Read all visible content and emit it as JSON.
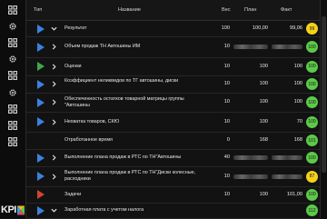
{
  "header": {
    "type_label": "Тип",
    "name_label": "Название",
    "weight_label": "Вес",
    "plan_label": "План",
    "fact_label": "Факт"
  },
  "logo": {
    "text": "KPI"
  },
  "sidebar": {
    "icons": [
      "grid-icon",
      "gear-icon",
      "grid-icon",
      "gear-icon",
      "grid-icon",
      "grid-icon",
      "grid-icon",
      "grid-icon"
    ]
  },
  "rows": [
    {
      "type": "blue",
      "chevron": "down",
      "name": "Результат",
      "weight": "100",
      "plan": "100,00",
      "fact": "99,06",
      "badge": "99",
      "badge_color": "#f4d11a"
    },
    {
      "type": "blue",
      "chevron": "right",
      "name": "Объем продаж ТН Автошины ИМ",
      "weight": "10",
      "plan": "",
      "fact": "",
      "badge": "100",
      "badge_color": "#5cc94a"
    },
    {
      "type": "green",
      "chevron": "right",
      "name": "Оценки",
      "weight": "10",
      "plan": "100",
      "fact": "100",
      "badge": "100",
      "badge_color": "#5cc94a"
    },
    {
      "type": "blue",
      "chevron": "right",
      "name": "Коэффициент неликвидов по ТГ  автошины, диски",
      "weight": "10",
      "plan": "100",
      "fact": "100",
      "badge": "100",
      "badge_color": "#5cc94a"
    },
    {
      "type": "blue",
      "chevron": "right",
      "name": "Обеспеченность остатков товарной матрицы группы \"Автошины",
      "weight": "10",
      "plan": "100",
      "fact": "100",
      "badge": "100",
      "badge_color": "#5cc94a"
    },
    {
      "type": "blue",
      "chevron": "right",
      "name": "Нехватка товаров, СКЮ",
      "weight": "10",
      "plan": "100",
      "fact": "70",
      "badge": "100",
      "badge_color": "#5cc94a"
    },
    {
      "type": "none",
      "chevron": "none",
      "name": "Отработанное время",
      "weight": "0",
      "plan": "168",
      "fact": "168",
      "badge": "101",
      "badge_color": "#5cc94a"
    },
    {
      "type": "blue",
      "chevron": "right",
      "name": "Выполнение плана продаж в РТС по ТН\"Автошины",
      "weight": "40",
      "plan": "",
      "fact": "",
      "badge": "100",
      "badge_color": "#5cc94a"
    },
    {
      "type": "blue",
      "chevron": "right",
      "name": "Выполнение плана продаж в РТС по ТН\"Диски колесные, расходники",
      "weight": "10",
      "plan": "",
      "fact": "",
      "badge": "87",
      "badge_color": "#f4d11a"
    },
    {
      "type": "red",
      "chevron": "none",
      "name": "Задачи",
      "weight": "10",
      "plan": "100",
      "fact": "101,00",
      "badge": "100",
      "badge_color": "#5cc94a"
    },
    {
      "type": "blue",
      "chevron": "down",
      "name": "Заработная плата с учетом налога",
      "weight": "",
      "plan": "",
      "fact": "",
      "badge": "112",
      "badge_color": "#5cc94a"
    }
  ],
  "colors": {
    "blue": "#3b82e0",
    "green": "#3fa84a",
    "red": "#d0452f",
    "badge_green": "#5cc94a",
    "badge_yellow": "#f4d11a"
  }
}
